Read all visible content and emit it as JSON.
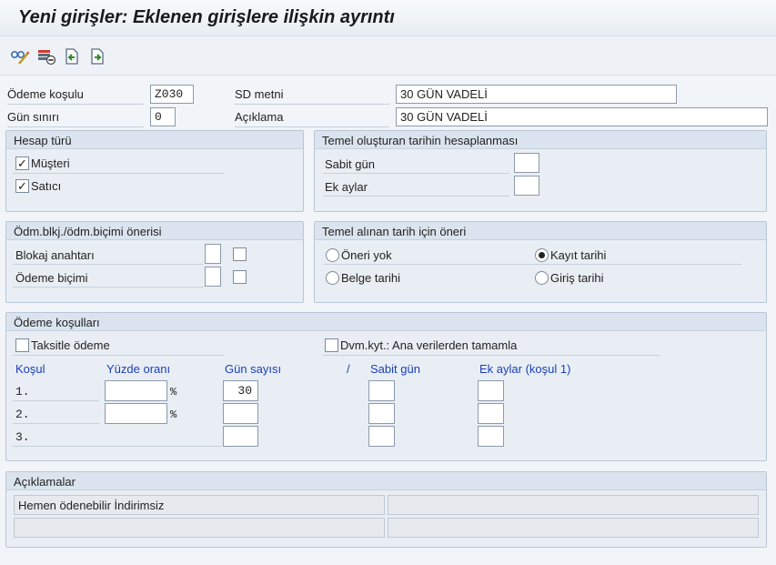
{
  "title": "Yeni girişler: Eklenen girişlere ilişkin ayrıntı",
  "header": {
    "payment_term_label": "Ödeme koşulu",
    "payment_term_value": "Z030",
    "day_limit_label": "Gün sınırı",
    "day_limit_value": "0",
    "sd_text_label": "SD metni",
    "sd_text_value": "30 GÜN VADELİ",
    "description_label": "Açıklama",
    "description_value": "30 GÜN VADELİ"
  },
  "account_type": {
    "title": "Hesap türü",
    "customer_label": "Müşteri",
    "customer_checked": true,
    "vendor_label": "Satıcı",
    "vendor_checked": true
  },
  "baseline_calc": {
    "title": "Temel oluşturan tarihin hesaplanması",
    "fixed_day_label": "Sabit gün",
    "fixed_day_value": "",
    "extra_months_label": "Ek aylar",
    "extra_months_value": ""
  },
  "payment_block": {
    "title": "Ödm.blkj./ödm.biçimi önerisi",
    "block_key_label": "Blokaj anahtarı",
    "payment_method_label": "Ödeme biçimi"
  },
  "baseline_default": {
    "title": "Temel alınan tarih için öneri",
    "options": [
      {
        "label": "Öneri yok",
        "selected": false
      },
      {
        "label": "Kayıt tarihi",
        "selected": true
      },
      {
        "label": "Belge tarihi",
        "selected": false
      },
      {
        "label": "Giriş tarihi",
        "selected": false
      }
    ]
  },
  "payment_terms": {
    "title": "Ödeme koşulları",
    "installment_label": "Taksitle ödeme",
    "installment_checked": false,
    "complete_label": "Dvm.kyt.: Ana verilerden tamamla",
    "complete_checked": false,
    "col_term": "Koşul",
    "col_percent": "Yüzde oranı",
    "col_days": "Gün sayısı",
    "col_slash": "/",
    "col_fixed_day": "Sabit gün",
    "col_extra_months": "Ek aylar (koşul 1)",
    "percent_sign": "%",
    "rows": [
      {
        "label": "1.",
        "percent": "",
        "days": "30",
        "fixed_day": "",
        "extra_months": ""
      },
      {
        "label": "2.",
        "percent": "",
        "days": "",
        "fixed_day": "",
        "extra_months": ""
      },
      {
        "label": "3.",
        "days": "",
        "fixed_day": "",
        "extra_months": ""
      }
    ]
  },
  "notes": {
    "title": "Açıklamalar",
    "lines": [
      "Hemen ödenebilir İndirimsiz",
      "",
      "",
      ""
    ]
  },
  "toolbar": {
    "icons": [
      "glasses-pencil-icon",
      "delete-row-icon",
      "previous-entry-icon",
      "next-entry-icon"
    ]
  }
}
